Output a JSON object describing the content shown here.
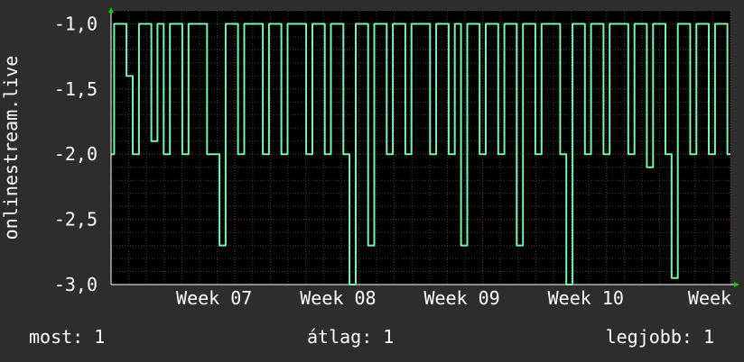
{
  "chart_data": {
    "type": "line",
    "ylabel": "onlinestream.live",
    "ylim": [
      -3.0,
      -0.9
    ],
    "yticks": [
      -1.0,
      -1.5,
      -2.0,
      -2.5,
      -3.0
    ],
    "ytick_labels": [
      "-1,0",
      "-1,5",
      "-2,0",
      "-2,5",
      "-3,0"
    ],
    "xticks": [
      7,
      8,
      9,
      10,
      11
    ],
    "xtick_labels": [
      "Week 07",
      "Week 08",
      "Week 09",
      "Week 10",
      "Week"
    ],
    "x": [
      6.0,
      6.05,
      6.1,
      6.15,
      6.2,
      6.25,
      6.3,
      6.35,
      6.4,
      6.45,
      6.5,
      6.55,
      6.6,
      6.65,
      6.7,
      6.75,
      6.8,
      6.85,
      6.9,
      6.95,
      7.0,
      7.05,
      7.1,
      7.15,
      7.2,
      7.25,
      7.3,
      7.35,
      7.4,
      7.45,
      7.5,
      7.55,
      7.6,
      7.65,
      7.7,
      7.75,
      7.8,
      7.85,
      7.9,
      7.95,
      8.0,
      8.05,
      8.1,
      8.15,
      8.2,
      8.25,
      8.3,
      8.35,
      8.4,
      8.45,
      8.5,
      8.55,
      8.6,
      8.65,
      8.7,
      8.75,
      8.8,
      8.85,
      8.9,
      8.95,
      9.0,
      9.05,
      9.1,
      9.15,
      9.2,
      9.25,
      9.3,
      9.35,
      9.4,
      9.45,
      9.5,
      9.55,
      9.6,
      9.65,
      9.7,
      9.75,
      9.8,
      9.85,
      9.9,
      9.95,
      10.0,
      10.05,
      10.1,
      10.15,
      10.2,
      10.25,
      10.3,
      10.35,
      10.4,
      10.45,
      10.5,
      10.55,
      10.6,
      10.65,
      10.7,
      10.75,
      10.8,
      10.85,
      10.9,
      10.95,
      11.0
    ],
    "series": [
      {
        "values": [
          -2.0,
          -1.0,
          -1.0,
          -1.4,
          -2.0,
          -1.0,
          -1.0,
          -1.9,
          -1.0,
          -2.0,
          -1.0,
          -1.0,
          -2.0,
          -1.0,
          -1.0,
          -1.0,
          -2.0,
          -2.0,
          -2.7,
          -1.0,
          -1.0,
          -2.0,
          -1.0,
          -1.0,
          -1.0,
          -2.0,
          -1.0,
          -1.0,
          -2.0,
          -1.0,
          -1.0,
          -1.0,
          -2.0,
          -1.0,
          -1.0,
          -2.0,
          -1.0,
          -1.0,
          -2.0,
          -3.0,
          -1.0,
          -1.0,
          -2.7,
          -1.0,
          -1.0,
          -2.0,
          -1.0,
          -1.0,
          -2.0,
          -1.0,
          -1.0,
          -1.0,
          -2.0,
          -1.0,
          -1.0,
          -2.0,
          -1.0,
          -2.7,
          -1.0,
          -1.0,
          -2.0,
          -1.0,
          -1.0,
          -2.0,
          -1.0,
          -1.0,
          -2.7,
          -1.0,
          -1.0,
          -2.0,
          -1.0,
          -1.0,
          -1.0,
          -2.0,
          -3.0,
          -1.0,
          -1.0,
          -2.0,
          -1.0,
          -1.0,
          -2.0,
          -1.0,
          -1.0,
          -1.0,
          -2.0,
          -1.0,
          -1.0,
          -2.1,
          -1.0,
          -1.0,
          -2.0,
          -2.95,
          -1.0,
          -1.0,
          -2.0,
          -1.0,
          -1.0,
          -2.0,
          -1.0,
          -1.0,
          -2.0
        ]
      }
    ],
    "line_color": "#7ef0b0",
    "grid": true
  },
  "stats": {
    "now": "most: 1",
    "avg": "átlag: 1",
    "max": "legjobb: 1"
  }
}
